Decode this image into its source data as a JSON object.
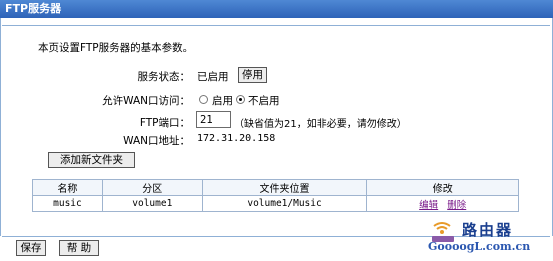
{
  "window": {
    "title": "FTP服务器"
  },
  "intro": "本页设置FTP服务器的基本参数。",
  "service_status": {
    "label": "服务状态：",
    "value": "已启用",
    "button": "停用"
  },
  "wan_access": {
    "label": "允许WAN口访问：",
    "option_on": "启用",
    "option_off": "不启用",
    "selected": "不启用"
  },
  "ftp_port": {
    "label": "FTP端口：",
    "value": "21",
    "hint": "（缺省值为21，如非必要，请勿修改）"
  },
  "wan_address": {
    "label": "WAN口地址：",
    "value": "172.31.20.158"
  },
  "add_folder_button": "添加新文件夹",
  "table": {
    "headers": [
      "名称",
      "分区",
      "文件夹位置",
      "修改"
    ],
    "rows": [
      {
        "name": "music",
        "partition": "volume1",
        "location": "volume1/Music",
        "edit": "编辑",
        "delete": "删除"
      }
    ]
  },
  "footer": {
    "save": "保存",
    "help": "帮 助"
  },
  "watermark": {
    "text": "路由器",
    "domain": "GoooogL.com.cn"
  },
  "colors": {
    "titlebar": "#3a73c4",
    "border": "#8fb0d6",
    "link": "#7a1b8a"
  }
}
